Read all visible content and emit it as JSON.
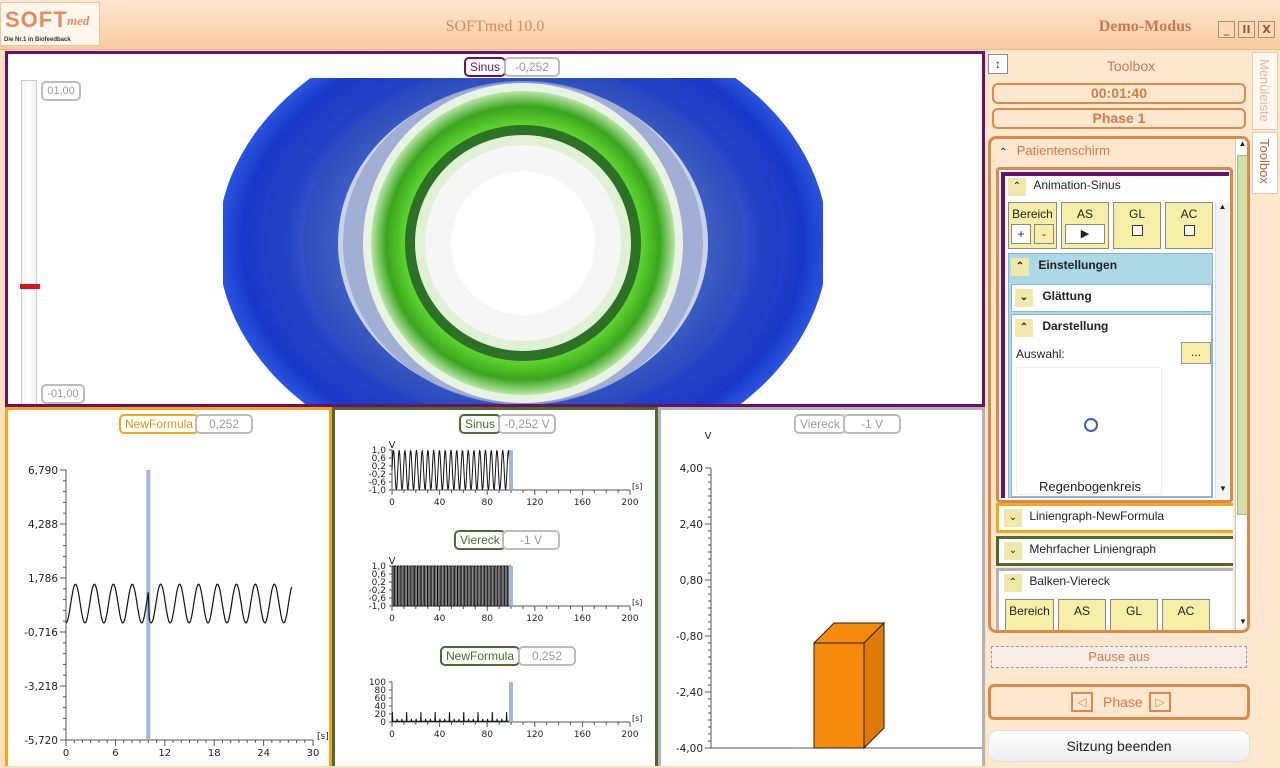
{
  "app": {
    "title": "SOFTmed 10.0",
    "mode": "Demo-Modus",
    "logo": {
      "main": "SOFT",
      "script": "med",
      "tagline": "Die Nr.1 in Biofeedback"
    },
    "window_buttons": [
      "_",
      "II",
      "X"
    ]
  },
  "animation_panel": {
    "channel_name": "Sinus",
    "channel_value": "-0,252",
    "scale_max": "01,00",
    "scale_min": "-01,00",
    "border_color": "#6b0f6b"
  },
  "chart_panel_left": {
    "channel_name": "NewFormula",
    "channel_value": "0,252",
    "border_color": "#f3a71c"
  },
  "chart_panel_middle": {
    "border_color": "#4c6b2d",
    "charts": [
      {
        "channel_name": "Sinus",
        "channel_value": "-0,252 V"
      },
      {
        "channel_name": "Viereck",
        "channel_value": "-1 V"
      },
      {
        "channel_name": "NewFormula",
        "channel_value": "0,252"
      }
    ]
  },
  "chart_panel_right": {
    "channel_name": "Viereck",
    "channel_value": "-1 V",
    "border_color": "#b3b3b3"
  },
  "chart_data": [
    {
      "type": "line",
      "series": [
        {
          "name": "NewFormula",
          "shape": "periodic sine-like waveform",
          "amplitude_approx": 0.9,
          "baseline_approx": 0.6,
          "extent_x": [
            0,
            27.5
          ]
        }
      ],
      "x_ticks": [
        "0",
        "6",
        "12",
        "18",
        "24",
        "30"
      ],
      "y_ticks": [
        "6,790",
        "4,288",
        "1,786",
        "-0,716",
        "-3,218",
        "-5,720"
      ],
      "xlim": [
        0,
        30
      ],
      "ylim": [
        -5.72,
        6.79
      ],
      "x_unit": "[s]",
      "cursor_x": 10
    },
    {
      "type": "line",
      "series": [
        {
          "name": "Sinus",
          "shape": "dense oscillation between -1 and 1",
          "extent_x": [
            0,
            100
          ]
        }
      ],
      "x_ticks": [
        "0",
        "40",
        "80",
        "120",
        "160",
        "200"
      ],
      "y_ticks": [
        "1,0",
        "0,6",
        "0,2",
        "-0,2",
        "-0,6",
        "-1,0"
      ],
      "y_unit": "V",
      "x_unit": "[s]",
      "xlim": [
        0,
        200
      ],
      "ylim": [
        -1,
        1
      ],
      "cursor_x": 100
    },
    {
      "type": "line",
      "series": [
        {
          "name": "Viereck",
          "shape": "dense square wave between -1 and 1",
          "extent_x": [
            0,
            100
          ]
        }
      ],
      "x_ticks": [
        "0",
        "40",
        "80",
        "120",
        "160",
        "200"
      ],
      "y_ticks": [
        "1,0",
        "0,6",
        "0,2",
        "-0,2",
        "-0,6",
        "-1,0"
      ],
      "y_unit": "V",
      "x_unit": "[s]",
      "xlim": [
        0,
        200
      ],
      "ylim": [
        -1,
        1
      ],
      "cursor_x": 100
    },
    {
      "type": "line",
      "series": [
        {
          "name": "NewFormula",
          "shape": "values near zero with short spikes",
          "extent_x": [
            0,
            100
          ]
        }
      ],
      "x_ticks": [
        "0",
        "40",
        "80",
        "120",
        "160",
        "200"
      ],
      "y_ticks": [
        "100",
        "80",
        "60",
        "40",
        "20",
        "0"
      ],
      "x_unit": "[s]",
      "xlim": [
        0,
        200
      ],
      "ylim": [
        0,
        100
      ],
      "cursor_x": 100
    },
    {
      "type": "bar",
      "categories": [
        "Viereck"
      ],
      "values": [
        -1
      ],
      "y_unit": "V",
      "y_ticks": [
        "4,00",
        "2,40",
        "0,80",
        "-0,80",
        "-2,40",
        "-4,00"
      ],
      "ylim": [
        -4,
        4
      ],
      "color": "#f58a0b"
    }
  ],
  "toolbox": {
    "title": "Toolbox",
    "timer": "00:01:40",
    "phase_label": "Phase 1",
    "side_tabs": [
      "Menüleiste",
      "Toolbox"
    ],
    "patientenschirm": "Patientenschirm",
    "animation_sinus": {
      "title": "Animation-Sinus",
      "buttons": {
        "bereich": "Bereich",
        "as": "AS",
        "gl": "GL",
        "ac": "AC"
      },
      "einstellungen": "Einstellungen",
      "glaettung": "Glättung",
      "darstellung": "Darstellung",
      "auswahl_label": "Auswahl:",
      "auswahl_button": "...",
      "selected_display": "Regenbogenkreis"
    },
    "liniengraph": "Liniengraph-NewFormula",
    "mehrfacher": "Mehrfacher Liniengraph",
    "balken": {
      "title": "Balken-Viereck",
      "buttons": {
        "bereich": "Bereich",
        "as": "AS",
        "gl": "GL",
        "ac": "AC"
      }
    },
    "pause_button": "Pause aus",
    "phase_nav_label": "Phase",
    "end_session": "Sitzung beenden"
  }
}
